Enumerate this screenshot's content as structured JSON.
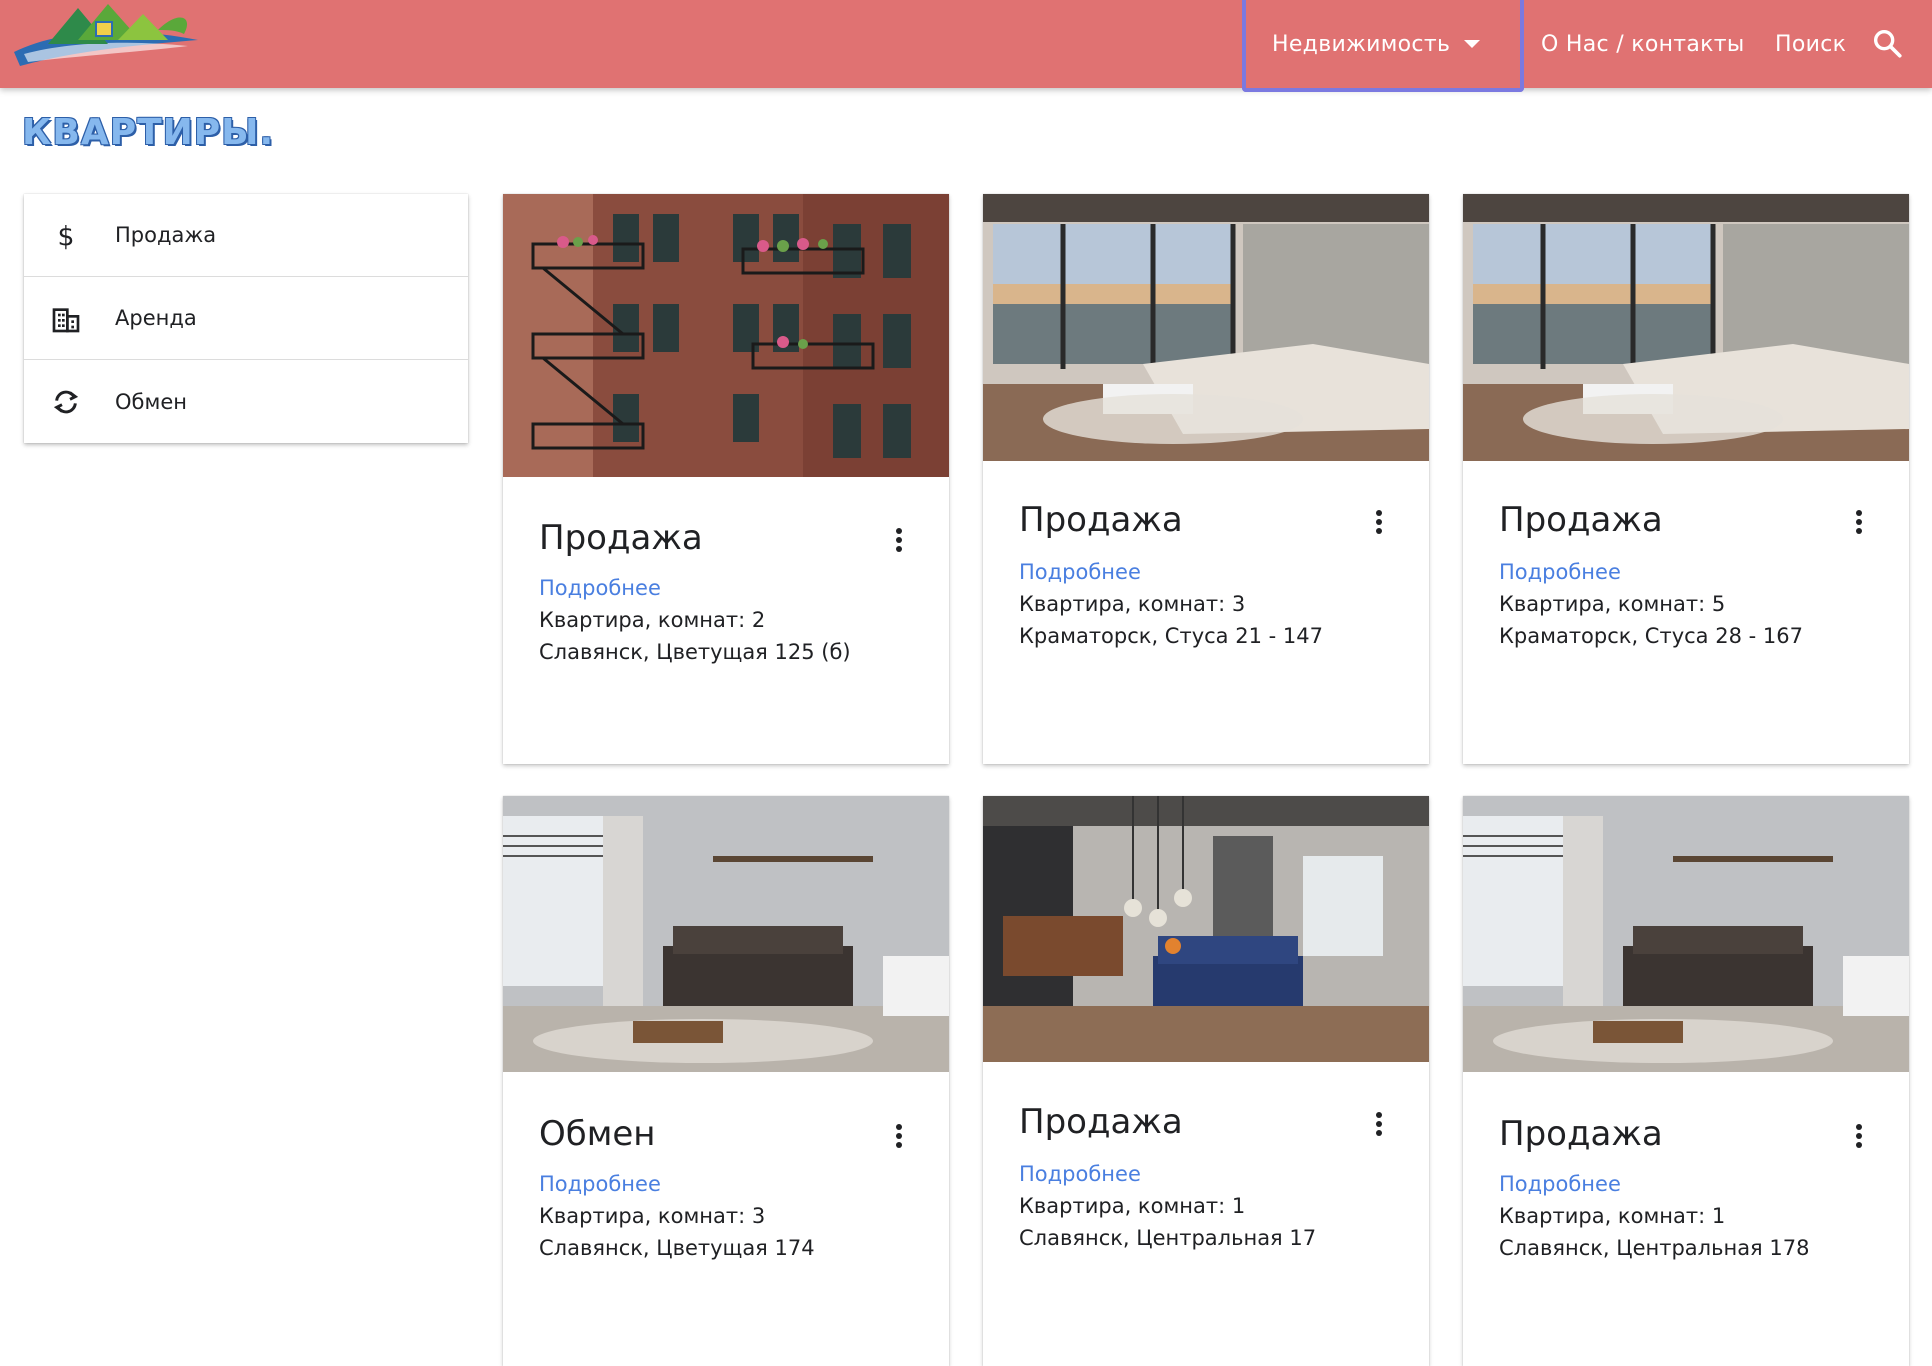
{
  "header": {
    "nav_realty": "Недвижимость",
    "nav_about": "О Нас / контакты",
    "nav_search": "Поиск",
    "bg_color": "#e07272",
    "active_outline_color": "#7b79e0"
  },
  "page": {
    "title": "КВАРТИРЫ."
  },
  "sidebar": {
    "items": [
      {
        "label": "Продажа",
        "icon": "dollar-icon"
      },
      {
        "label": "Аренда",
        "icon": "building-icon"
      },
      {
        "label": "Обмен",
        "icon": "sync-icon"
      }
    ]
  },
  "cards": [
    {
      "title": "Продажа",
      "link": "Подробнее",
      "line1": "Квартира, комнат: 2",
      "line2": "Славянск, Цветущая 125 (б)",
      "image": "brick-building-photo"
    },
    {
      "title": "Продажа",
      "link": "Подробнее",
      "line1": "Квартира, комнат: 3",
      "line2": "Краматорск, Стуса 21 - 147",
      "image": "panorama-living-room-photo"
    },
    {
      "title": "Продажа",
      "link": "Подробнее",
      "line1": "Квартира, комнат: 5",
      "line2": "Краматорск, Стуса 28 - 167",
      "image": "panorama-living-room-photo"
    },
    {
      "title": "Обмен",
      "link": "Подробнее",
      "line1": "Квартира, комнат: 3",
      "line2": "Славянск, Цветущая 174",
      "image": "grey-living-room-photo"
    },
    {
      "title": "Продажа",
      "link": "Подробнее",
      "line1": "Квартира, комнат: 1",
      "line2": "Славянск, Центральная 17",
      "image": "kitchen-living-room-photo"
    },
    {
      "title": "Продажа",
      "link": "Подробнее",
      "line1": "Квартира, комнат: 1",
      "line2": "Славянск, Центральная 178",
      "image": "grey-living-room-photo"
    }
  ],
  "link_color": "#4a7fe0"
}
